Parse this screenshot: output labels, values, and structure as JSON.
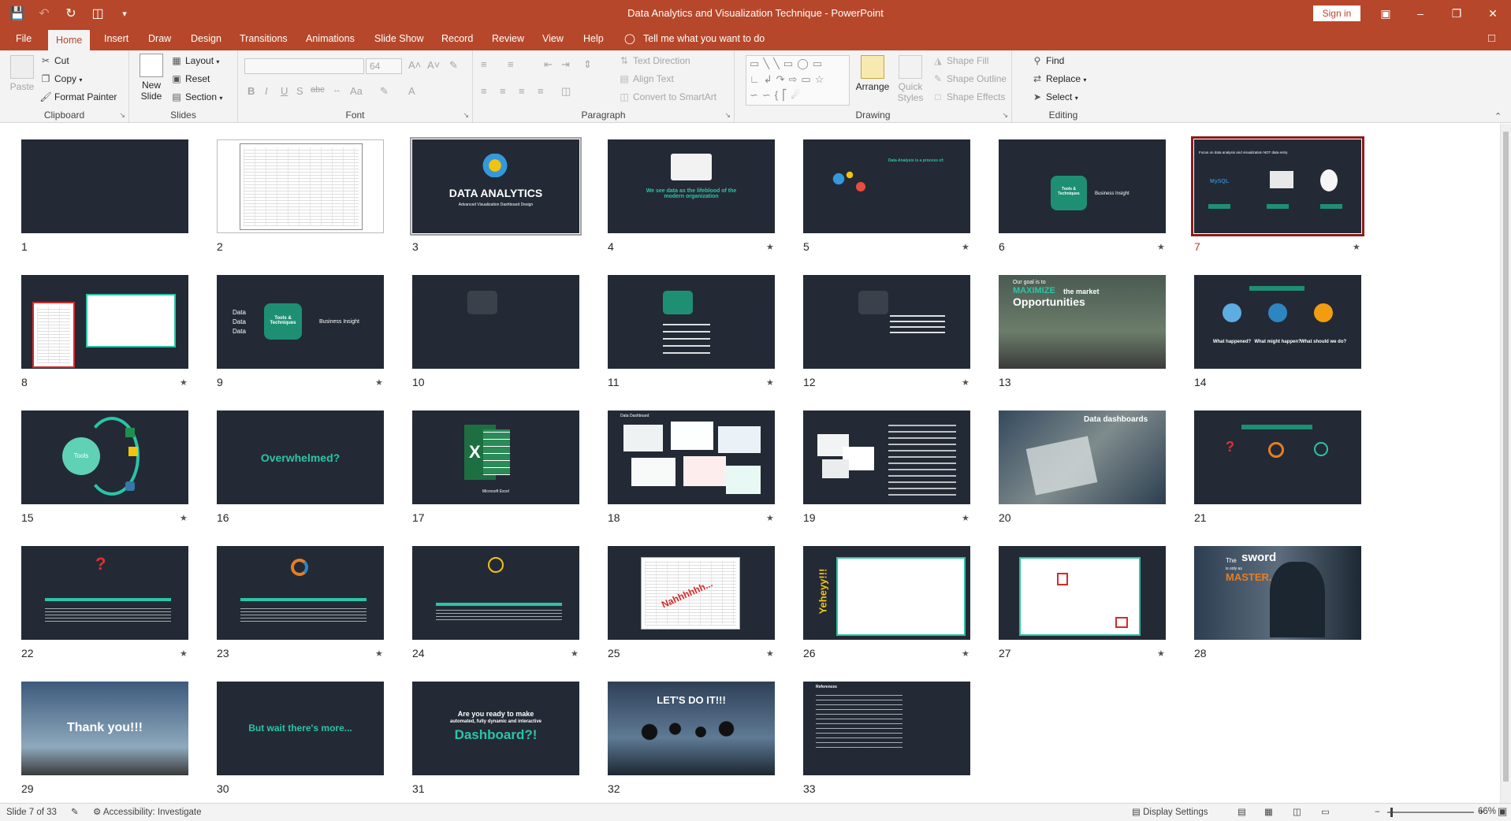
{
  "window": {
    "title": "Data Analytics and Visualization Technique  -  PowerPoint",
    "sign_in": "Sign in",
    "quick_access": [
      "save-icon",
      "undo-icon",
      "redo-icon",
      "present-from-beginning-icon",
      "customize-icon"
    ]
  },
  "tabs": [
    "File",
    "Home",
    "Insert",
    "Draw",
    "Design",
    "Transitions",
    "Animations",
    "Slide Show",
    "Record",
    "Review",
    "View",
    "Help"
  ],
  "active_tab": "Home",
  "tell_me": "Tell me what you want to do",
  "ribbon": {
    "clipboard": {
      "label": "Clipboard",
      "paste": "Paste",
      "cut": "Cut",
      "copy": "Copy",
      "format_painter": "Format Painter"
    },
    "slides": {
      "label": "Slides",
      "new_slide": "New Slide",
      "layout": "Layout",
      "reset": "Reset",
      "section": "Section"
    },
    "font": {
      "label": "Font",
      "font_name": "",
      "font_size": "64"
    },
    "paragraph": {
      "label": "Paragraph",
      "text_direction": "Text Direction",
      "align_text": "Align Text",
      "convert_smartart": "Convert to SmartArt"
    },
    "drawing": {
      "label": "Drawing",
      "arrange": "Arrange",
      "quick_styles": "Quick Styles",
      "shape_fill": "Shape Fill",
      "shape_outline": "Shape Outline",
      "shape_effects": "Shape Effects"
    },
    "editing": {
      "label": "Editing",
      "find": "Find",
      "replace": "Replace",
      "select": "Select"
    }
  },
  "slides": [
    {
      "n": "1"
    },
    {
      "n": "2"
    },
    {
      "n": "3",
      "title": "DATA ANALYTICS",
      "subtitle": "Advanced Visualization Dashboard Design"
    },
    {
      "n": "4",
      "text": "We see data as the lifeblood of the modern organization"
    },
    {
      "n": "5",
      "text": "Data Analysis is a process of:"
    },
    {
      "n": "6",
      "text": "Business Insight",
      "center": "Tools & Techniques"
    },
    {
      "n": "7",
      "text": "Focus on data analysis and visualization NOT data entry",
      "logo": "MySQL"
    },
    {
      "n": "8"
    },
    {
      "n": "9",
      "text": "Business Insight",
      "center": "Tools & Techniques",
      "data": "Data"
    },
    {
      "n": "10"
    },
    {
      "n": "11"
    },
    {
      "n": "12"
    },
    {
      "n": "13",
      "line1": "Our goal is to",
      "line2": "MAXIMIZE",
      "line3": "the market",
      "line4": "Opportunities"
    },
    {
      "n": "14",
      "q1": "What happened?",
      "q2": "What might happen?",
      "q3": "What should we do?"
    },
    {
      "n": "15",
      "text": "Tools"
    },
    {
      "n": "16",
      "text": "Overwhelmed?"
    },
    {
      "n": "17",
      "text": "Microsoft Excel"
    },
    {
      "n": "18",
      "text": "Data Dashboard"
    },
    {
      "n": "19"
    },
    {
      "n": "20",
      "text": "Data dashboards"
    },
    {
      "n": "21"
    },
    {
      "n": "22"
    },
    {
      "n": "23"
    },
    {
      "n": "24"
    },
    {
      "n": "25",
      "text": "Nahhhhhh..."
    },
    {
      "n": "26",
      "text": "Yeheyy!!!"
    },
    {
      "n": "27"
    },
    {
      "n": "28",
      "line1": "The",
      "line2": "sword",
      "line3": "is only as",
      "line4": "MASTER."
    },
    {
      "n": "29",
      "text": "Thank you!!!"
    },
    {
      "n": "30",
      "text": "But wait there's more..."
    },
    {
      "n": "31",
      "line1": "Are you ready to make",
      "line2": "automated, fully dynamic and interactive",
      "line3": "Dashboard?!"
    },
    {
      "n": "32",
      "text": "LET'S DO IT!!!"
    },
    {
      "n": "33",
      "text": "References"
    }
  ],
  "selected_slide": "7",
  "status": {
    "slide_count": "Slide 7 of 33",
    "accessibility": "Accessibility: Investigate",
    "display_settings": "Display Settings",
    "zoom": "66%"
  },
  "colors": {
    "brand": "#b7472a",
    "slide_bg": "#232a35",
    "accent": "#2bc4a7",
    "selected": "#8e1b1b"
  }
}
